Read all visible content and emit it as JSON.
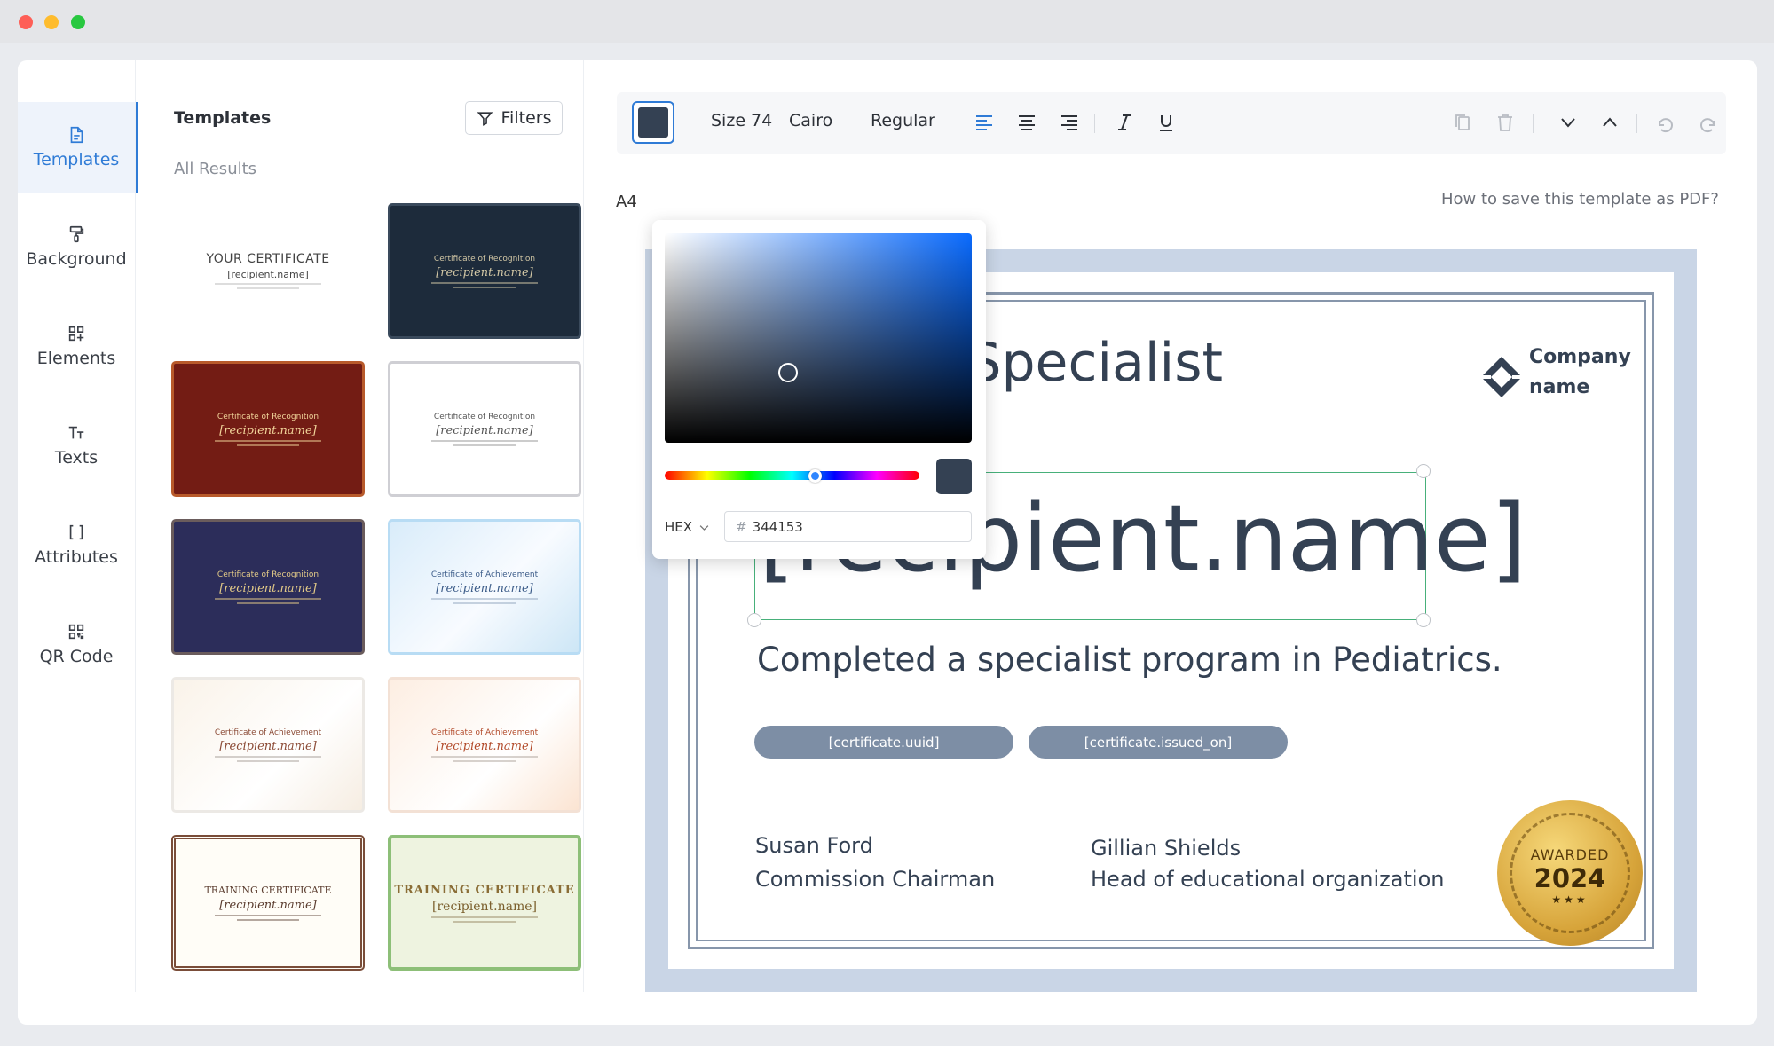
{
  "nav": {
    "items": [
      {
        "label": "Templates",
        "icon": "template-icon",
        "active": true
      },
      {
        "label": "Background",
        "icon": "paint-roller-icon"
      },
      {
        "label": "Elements",
        "icon": "elements-icon"
      },
      {
        "label": "Texts",
        "icon": "text-icon"
      },
      {
        "label": "Attributes",
        "icon": "brackets-icon"
      },
      {
        "label": "QR Code",
        "icon": "qr-code-icon"
      }
    ]
  },
  "templates_panel": {
    "title": "Templates",
    "filters_label": "Filters",
    "results_label": "All Results",
    "thumbnails": [
      {
        "title": "YOUR CERTIFICATE",
        "name": "[recipient.name]"
      },
      {
        "title": "Certificate of Recognition",
        "name": "[recipient.name]"
      },
      {
        "title": "Certificate of Recognition",
        "name": "[recipient.name]"
      },
      {
        "title": "Certificate of Recognition",
        "name": "[recipient.name]"
      },
      {
        "title": "Certificate of Recognition",
        "name": "[recipient.name]"
      },
      {
        "title": "Certificate of Achievement",
        "name": "[recipient.name]"
      },
      {
        "title": "Certificate of Achievement",
        "name": "[recipient.name]"
      },
      {
        "title": "Certificate of Achievement",
        "name": "[recipient.name]"
      },
      {
        "title": "TRAINING CERTIFICATE",
        "name": "[recipient.name]"
      },
      {
        "title": "TRAINING CERTIFICATE",
        "name": "[recipient.name]"
      }
    ]
  },
  "toolbar": {
    "color": "#344153",
    "size_label": "Size 74",
    "font_label": "Cairo",
    "weight_label": "Regular",
    "active_align": "left",
    "icons": [
      "align-left-icon",
      "align-center-icon",
      "align-right-icon",
      "italic-icon",
      "underline-icon",
      "copy-icon",
      "trash-icon",
      "chevron-down-icon",
      "chevron-up-icon",
      "undo-icon",
      "redo-icon"
    ]
  },
  "canvas": {
    "page_size_label": "A4",
    "help_link": "How to save this template as PDF?"
  },
  "certificate": {
    "title_fragment": "f Specialist",
    "company_name": "Company name",
    "recipient": "[recipient.name]",
    "description": "Completed a specialist program in Pediatrics.",
    "pills": [
      "[certificate.uuid]",
      "[certificate.issued_on]"
    ],
    "signatories": [
      {
        "name": "Susan Ford",
        "role": "Commission Chairman"
      },
      {
        "name": "Gillian Shields",
        "role": "Head of educational organization"
      }
    ],
    "seal": {
      "label": "AWARDED",
      "year": "2024",
      "stars": "★★★"
    }
  },
  "color_picker": {
    "mode": "HEX",
    "hash": "#",
    "hex_value": "344153",
    "accent": "#0a6bff"
  }
}
